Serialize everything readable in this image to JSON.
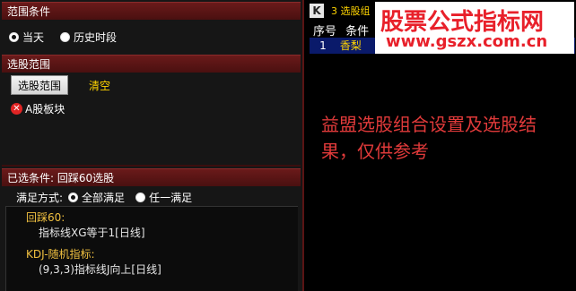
{
  "scope": {
    "header": "范围条件",
    "options": [
      "当天",
      "历史时段"
    ],
    "selected": 0
  },
  "range": {
    "header": "选股范围",
    "button_label": "选股范围",
    "clear_label": "清空",
    "items": [
      {
        "label": "A股板块"
      }
    ]
  },
  "conditions": {
    "header": "已选条件: 回踩60选股",
    "mode_label": "满足方式:",
    "mode_options": [
      "全部满足",
      "任一满足"
    ],
    "mode_selected": 0,
    "items": [
      {
        "title": "回踩60:",
        "detail": "指标线XG等于1[日线]"
      },
      {
        "title": "KDJ-随机指标:",
        "detail": "(9,3,3)指标线J向上[日线]"
      }
    ]
  },
  "result": {
    "icon": "K",
    "title": "3 选股组",
    "columns": [
      "序号",
      "条件"
    ],
    "rows": [
      {
        "index": "1",
        "name": "香梨"
      }
    ]
  },
  "watermark": {
    "line1": "股票公式指标网",
    "line2": "www.gszx.com.cn"
  },
  "note": "益盟选股组合设置及选股结果，仅供参考",
  "colors": {
    "header_bg": "#5a1414",
    "accent_yellow": "#ffd400",
    "note_red": "#e03a3a",
    "watermark_red": "#e8202a",
    "selected_row_bg": "#0a1a6a"
  }
}
